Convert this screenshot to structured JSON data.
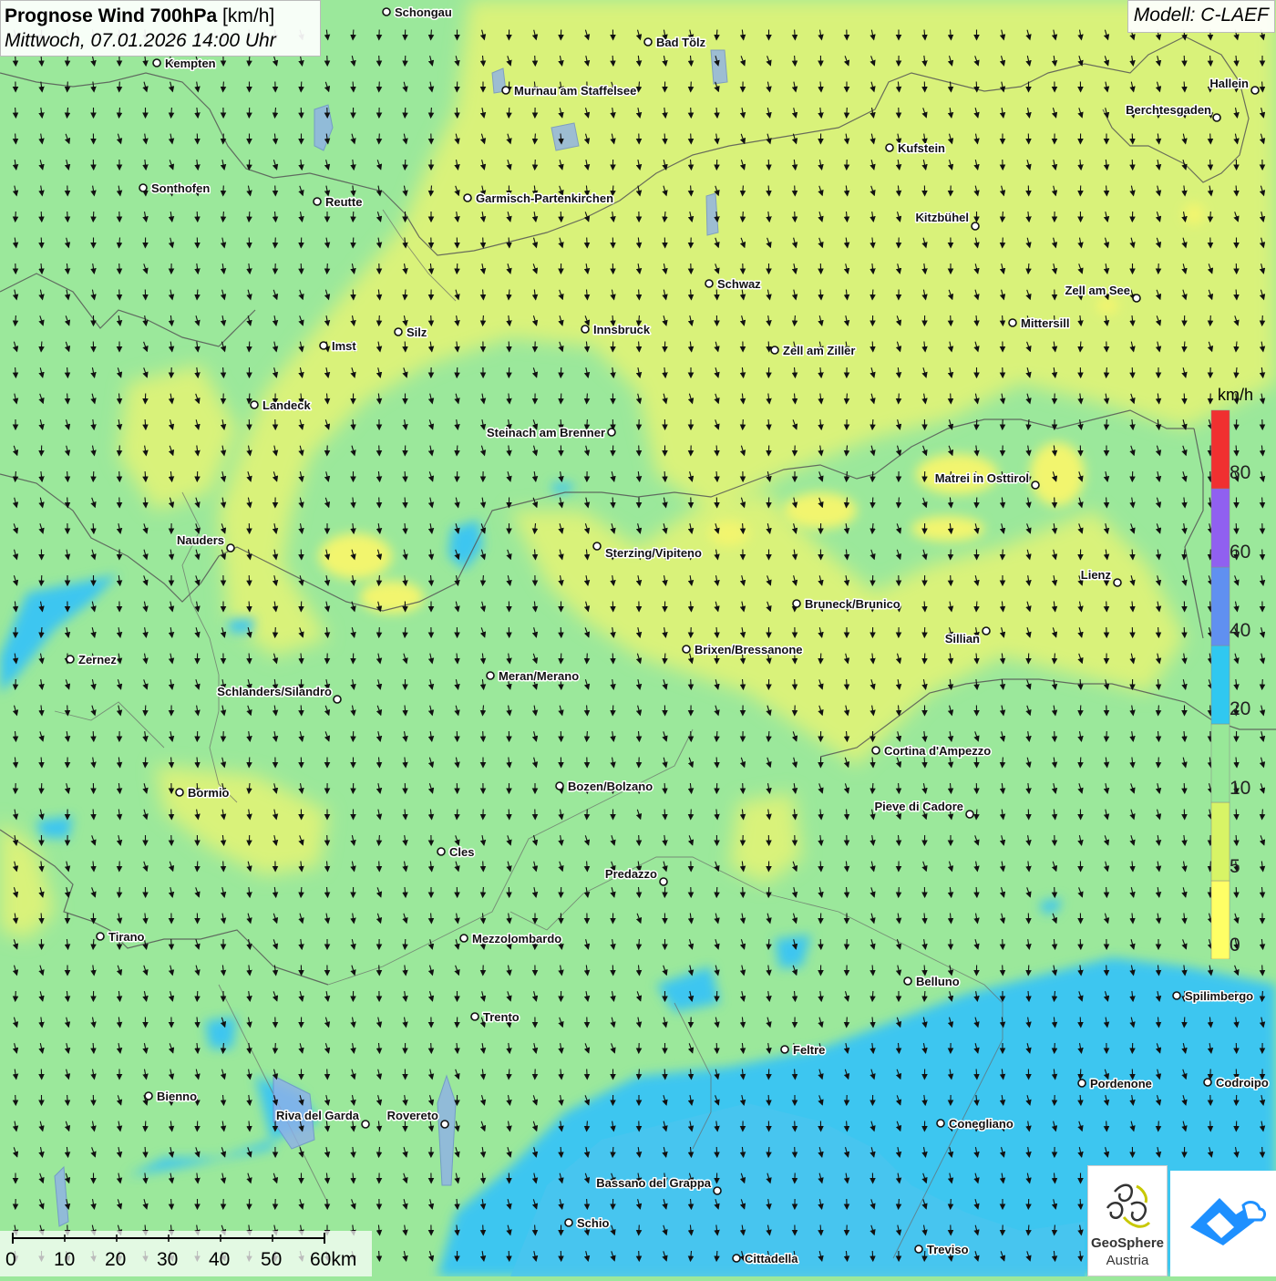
{
  "title": {
    "main_bold": "Prognose Wind 700hPa",
    "unit": "[km/h]",
    "datetime": "Mittwoch, 07.01.2026 14:00 Uhr"
  },
  "model_label": "Modell: C-LAEF",
  "legend": {
    "unit": "km/h",
    "bins": [
      {
        "value": 0,
        "color": "#ffff66"
      },
      {
        "value": 5,
        "color": "#d8f466"
      },
      {
        "value": 10,
        "color": "#98e898"
      },
      {
        "value": 20,
        "color": "#30c8f0"
      },
      {
        "value": 40,
        "color": "#6090f0"
      },
      {
        "value": 60,
        "color": "#9060f0"
      },
      {
        "value": 80,
        "color": "#f03030"
      }
    ],
    "labels": [
      "0",
      "5",
      "10",
      "20",
      "40",
      "60",
      "80"
    ]
  },
  "scale": {
    "ticks": [
      "0",
      "10",
      "20",
      "30",
      "40",
      "50",
      "60km"
    ]
  },
  "logo": {
    "name": "GeoSphere",
    "sub": "Austria"
  },
  "cities": [
    {
      "name": "Schongau"
    },
    {
      "name": "Bad Tölz"
    },
    {
      "name": "Kempten"
    },
    {
      "name": "Murnau am Staffelsee"
    },
    {
      "name": "Hallein"
    },
    {
      "name": "Berchtesgaden"
    },
    {
      "name": "Kufstein"
    },
    {
      "name": "Sonthofen"
    },
    {
      "name": "Reutte"
    },
    {
      "name": "Garmisch-Partenkirchen"
    },
    {
      "name": "Kitzbühel"
    },
    {
      "name": "Schwaz"
    },
    {
      "name": "Zell am See"
    },
    {
      "name": "Mittersill"
    },
    {
      "name": "Innsbruck"
    },
    {
      "name": "Silz"
    },
    {
      "name": "Imst"
    },
    {
      "name": "Zell am Ziller"
    },
    {
      "name": "Landeck"
    },
    {
      "name": "Steinach am Brenner"
    },
    {
      "name": "Matrei in Osttirol"
    },
    {
      "name": "Nauders"
    },
    {
      "name": "Sterzing/Vipiteno"
    },
    {
      "name": "Lienz"
    },
    {
      "name": "Bruneck/Brunico"
    },
    {
      "name": "Sillian"
    },
    {
      "name": "Brixen/Bressanone"
    },
    {
      "name": "Zernez"
    },
    {
      "name": "Meran/Merano"
    },
    {
      "name": "Schlanders/Silandro"
    },
    {
      "name": "Cortina d'Ampezzo"
    },
    {
      "name": "Bozen/Bolzano"
    },
    {
      "name": "Bormio"
    },
    {
      "name": "Pieve di Cadore"
    },
    {
      "name": "Cles"
    },
    {
      "name": "Predazzo"
    },
    {
      "name": "Tirano"
    },
    {
      "name": "Mezzolombardo"
    },
    {
      "name": "Belluno"
    },
    {
      "name": "Spilimbergo"
    },
    {
      "name": "Trento"
    },
    {
      "name": "Feltre"
    },
    {
      "name": "Bienno"
    },
    {
      "name": "Pordenone"
    },
    {
      "name": "Codroipo"
    },
    {
      "name": "Riva del Garda"
    },
    {
      "name": "Rovereto"
    },
    {
      "name": "Conegliano"
    },
    {
      "name": "Bassano del Grappa"
    },
    {
      "name": "Schio"
    },
    {
      "name": "Treviso"
    },
    {
      "name": "Cittadella"
    }
  ],
  "wind_field": {
    "prevailing_direction": "from NNW",
    "arrow_color": "#111111"
  }
}
